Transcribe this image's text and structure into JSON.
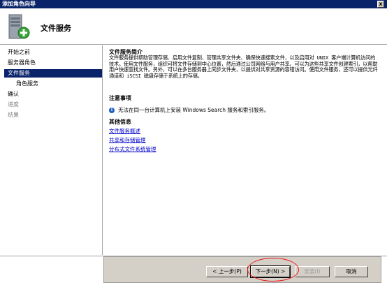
{
  "window": {
    "title": "添加角色向导",
    "close_label": "x"
  },
  "header": {
    "title": "文件服务",
    "icon": "server-with-plus-icon"
  },
  "nav": {
    "items": [
      {
        "label": "开始之前",
        "state": "normal"
      },
      {
        "label": "服务器角色",
        "state": "normal"
      },
      {
        "label": "文件服务",
        "state": "active"
      },
      {
        "label": "角色服务",
        "state": "sub"
      },
      {
        "label": "确认",
        "state": "normal"
      },
      {
        "label": "进度",
        "state": "disabled"
      },
      {
        "label": "结果",
        "state": "disabled"
      }
    ]
  },
  "content": {
    "intro_title": "文件服务简介",
    "intro_text": "文件服务提供帮助管理存储、启用文件复制、管理共享文件夹、确保快速搜索文件，以及启用对 UNIX 客户端计算机访问的技术。使用文件服务，组织可将文件存储到中心位置，然后通过公司网络与用户共享。可以为这些共享文件创建索引，以帮助用户快速查找文件。另外，可以在多台服务器上同步文件夹，以提供对共享资源的容错访问。使用文件服务，还可以提供光纤通道和 iSCSI 磁盘存储于系统上的存储。",
    "notes_title": "注意事项",
    "note_text": "无法在同一台计算机上安装 Windows Search 服务和索引服务。",
    "more_title": "其他信息",
    "links": [
      "文件服务概述",
      "共享和存储管理",
      "分布式文件系统管理"
    ]
  },
  "buttons": {
    "prev": "< 上一步(P)",
    "next": "下一步(N) >",
    "install": "安装(I)",
    "cancel": "取消"
  },
  "colors": {
    "title_bar": "#0a246a",
    "selection": "#0a246a",
    "link": "#0000cc",
    "annotation": "#e11111"
  }
}
